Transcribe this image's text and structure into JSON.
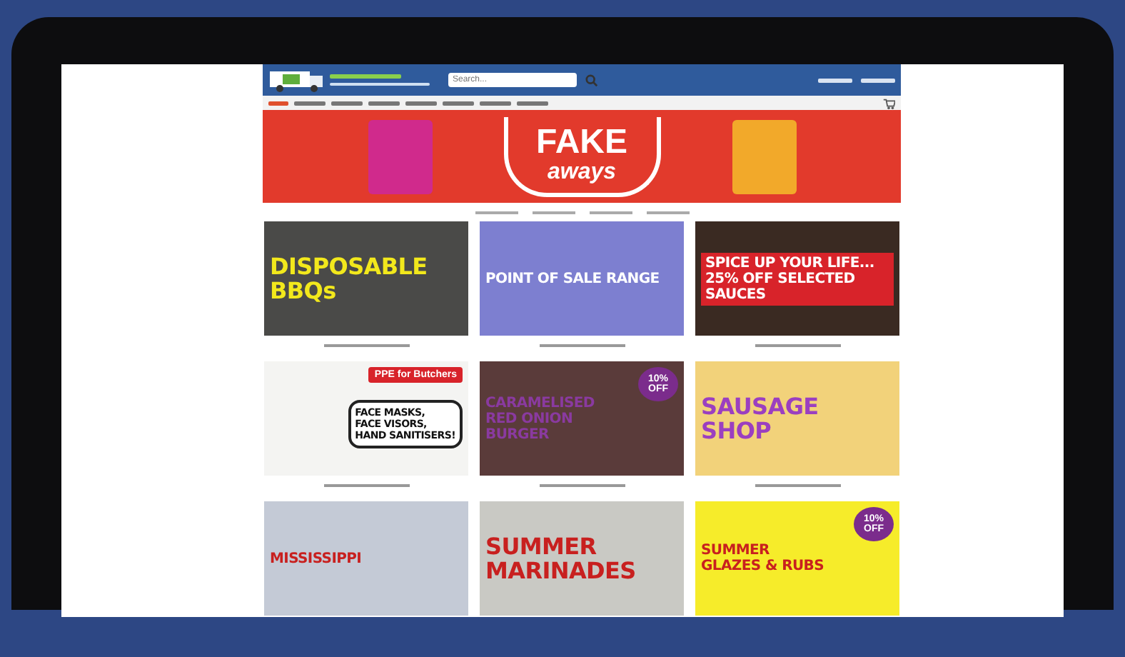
{
  "header": {
    "search": {
      "placeholder": "Search..."
    }
  },
  "hero": {
    "title": "FAKE",
    "subtitle": "aways"
  },
  "tiles": [
    {
      "headline": [
        "DISPOSABLE",
        "BBQs"
      ]
    },
    {
      "headline": [
        "POINT OF SALE RANGE"
      ]
    },
    {
      "headline": [
        "SPICE UP YOUR LIFE...",
        "25% OFF SELECTED SAUCES"
      ]
    },
    {
      "headline": [
        "FACE MASKS,",
        "FACE VISORS,",
        "HAND SANITISERS!"
      ],
      "badge": "PPE for Butchers"
    },
    {
      "headline": [
        "CARAMELISED",
        "RED ONION",
        "BURGER"
      ],
      "badge": "10% OFF"
    },
    {
      "headline": [
        "SAUSAGE",
        "SHOP"
      ]
    },
    {
      "headline": [
        "MISSISSIPPI"
      ]
    },
    {
      "headline": [
        "SUMMER",
        "MARINADES"
      ]
    },
    {
      "headline": [
        "SUMMER",
        "GLAZES & RUBS"
      ],
      "badge": "10% OFF"
    }
  ]
}
